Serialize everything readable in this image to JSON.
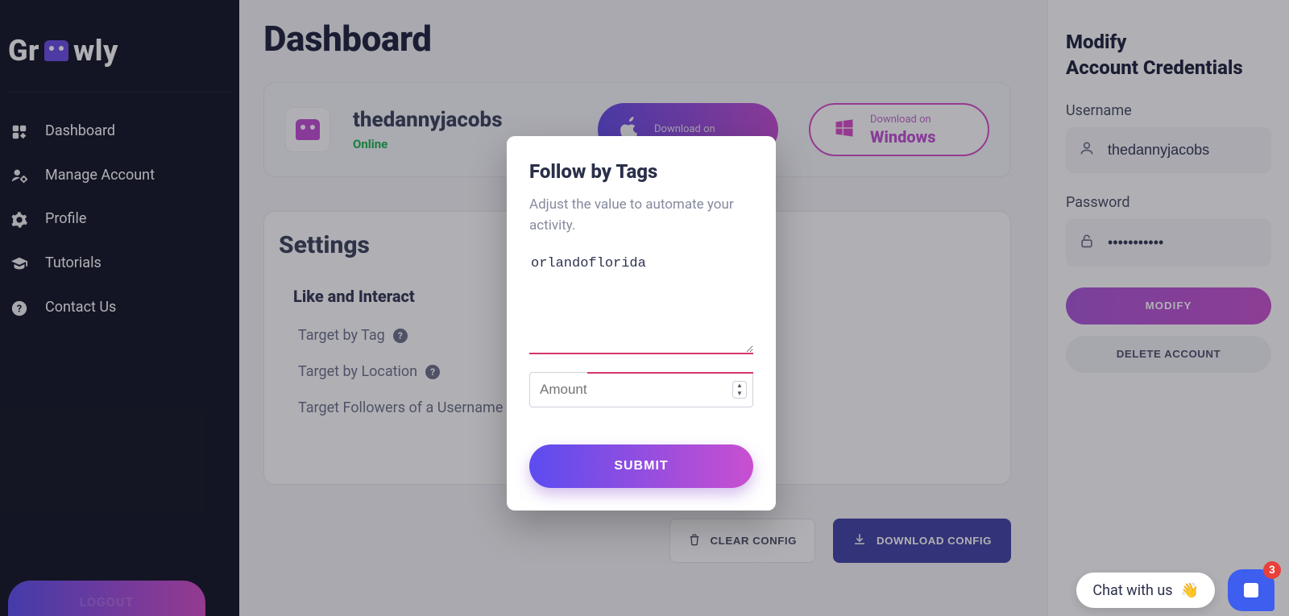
{
  "brand": {
    "name_pre": "Gr",
    "name_post": "wly"
  },
  "nav": {
    "items": [
      {
        "label": "Dashboard"
      },
      {
        "label": "Manage Account"
      },
      {
        "label": "Profile"
      },
      {
        "label": "Tutorials"
      },
      {
        "label": "Contact Us"
      }
    ],
    "logout": "LOGOUT"
  },
  "page": {
    "title": "Dashboard"
  },
  "account": {
    "username": "thedannyjacobs",
    "status": "Online"
  },
  "download": {
    "pre": "Download on",
    "apple": "",
    "windows": "Windows"
  },
  "settings": {
    "title": "Settings",
    "section": "Like and Interact",
    "rows": [
      {
        "label": "Target by Tag",
        "help": true
      },
      {
        "label": "Target by Location",
        "help": true
      },
      {
        "label": "Target Followers of a Username",
        "help": false
      }
    ]
  },
  "config_actions": {
    "clear": "CLEAR CONFIG",
    "download": "DOWNLOAD CONFIG"
  },
  "right": {
    "title_l1": "Modify",
    "title_l2": "Account Credentials",
    "username_label": "Username",
    "username_value": "thedannyjacobs",
    "password_label": "Password",
    "password_value": "•••••••••••",
    "modify": "MODIFY",
    "delete": "DELETE ACCOUNT"
  },
  "modal": {
    "title": "Follow by Tags",
    "desc": "Adjust the value to automate your activity.",
    "tags_value": "orlandoflorida",
    "amount_placeholder": "Amount",
    "submit": "SUBMIT"
  },
  "chat": {
    "text": "Chat with us",
    "emoji": "👋",
    "badge": "3"
  }
}
